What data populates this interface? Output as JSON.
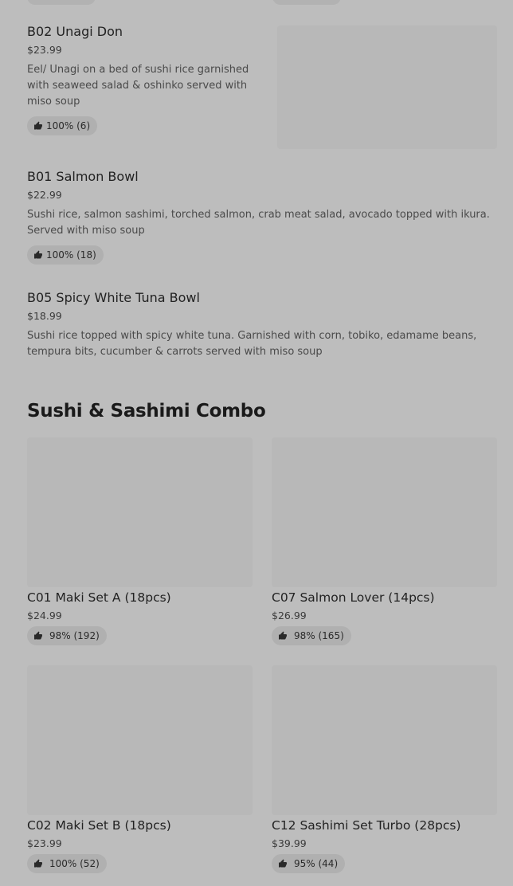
{
  "rating_icon": "thumbs-up-icon",
  "colors": {
    "overlay_background": "#bdbdbd",
    "pill_background": "#b0b0b0",
    "image_placeholder": "#b8b8b8"
  },
  "bowls": [
    {
      "name": "B02 Unagi Don",
      "price": "$23.99",
      "description": "Eel/ Unagi on a bed of sushi rice garnished with seaweed salad & oshinko served with miso soup",
      "rating": "100% (6)"
    },
    {
      "name": "B01 Salmon Bowl",
      "price": "$22.99",
      "description": "Sushi rice, salmon sashimi, torched salmon, crab meat salad, avocado topped with ikura. Served with miso soup",
      "rating": "100% (18)"
    },
    {
      "name": "B05 Spicy White Tuna Bowl",
      "price": "$18.99",
      "description": "Sushi rice topped with spicy white tuna. Garnished with corn, tobiko, edamame beans, tempura bits, cucumber & carrots served with miso soup"
    }
  ],
  "combo_section": {
    "title": "Sushi & Sashimi Combo",
    "cards": [
      {
        "name": "C01 Maki Set A (18pcs)",
        "price": "$24.99",
        "rating": "98% (192)"
      },
      {
        "name": "C07 Salmon Lover (14pcs)",
        "price": "$26.99",
        "rating": "98% (165)"
      },
      {
        "name": "C02 Maki Set B (18pcs)",
        "price": "$23.99",
        "rating": "100% (52)"
      },
      {
        "name": "C12 Sashimi Set Turbo (28pcs)",
        "price": "$39.99",
        "rating": "95% (44)"
      }
    ]
  }
}
